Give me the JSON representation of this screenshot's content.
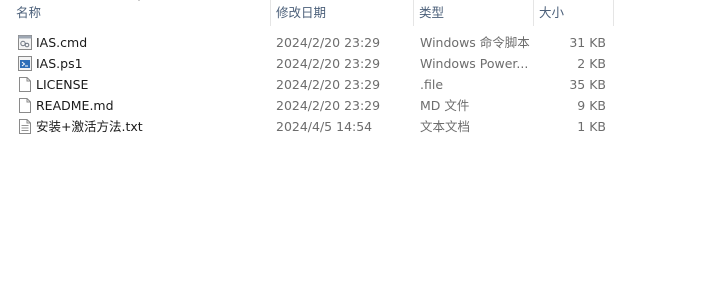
{
  "columns": {
    "name": "名称",
    "date": "修改日期",
    "type": "类型",
    "size": "大小"
  },
  "files": [
    {
      "name": "IAS.cmd",
      "date": "2024/2/20 23:29",
      "type": "Windows 命令脚本",
      "size": "31 KB",
      "icon": "cmd-script-icon"
    },
    {
      "name": "IAS.ps1",
      "date": "2024/2/20 23:29",
      "type": "Windows Power...",
      "size": "2 KB",
      "icon": "powershell-script-icon"
    },
    {
      "name": "LICENSE",
      "date": "2024/2/20 23:29",
      "type": ".file",
      "size": "35 KB",
      "icon": "generic-file-icon"
    },
    {
      "name": "README.md",
      "date": "2024/2/20 23:29",
      "type": "MD 文件",
      "size": "9 KB",
      "icon": "generic-file-icon"
    },
    {
      "name": "安装+激活方法.txt",
      "date": "2024/4/5 14:54",
      "type": "文本文档",
      "size": "1 KB",
      "icon": "text-document-icon"
    }
  ]
}
